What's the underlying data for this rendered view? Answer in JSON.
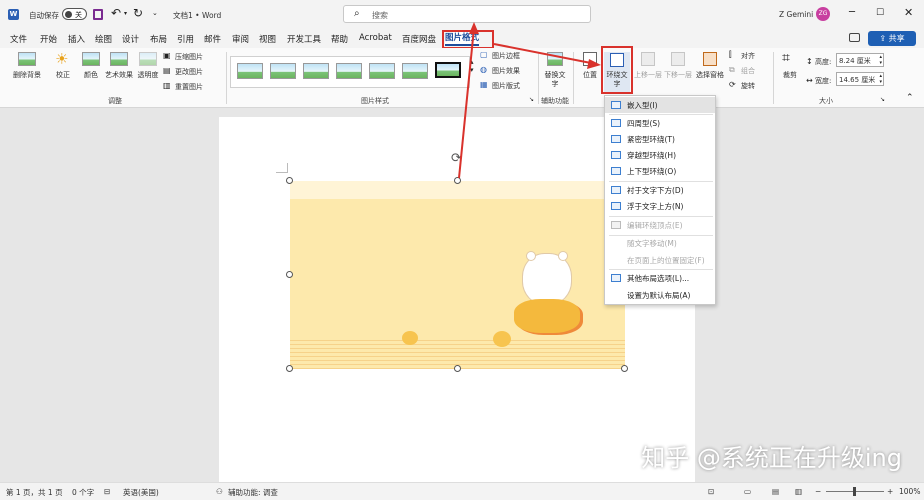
{
  "titlebar": {
    "autosave_label": "自动保存",
    "autosave_state": "关",
    "doc_title": "文档1  •  Word",
    "search_placeholder": "搜索",
    "user_name": "Z Gemini",
    "user_initials": "ZG"
  },
  "menu": {
    "tabs": [
      "文件",
      "开始",
      "插入",
      "绘图",
      "设计",
      "布局",
      "引用",
      "邮件",
      "审阅",
      "视图",
      "开发工具",
      "帮助",
      "Acrobat",
      "百度网盘"
    ],
    "active_tab": "图片格式",
    "share_label": "共享"
  },
  "ribbon": {
    "remove_bg": "删除背景",
    "correct": "校正",
    "color": "颜色",
    "artistic": "艺术效果",
    "transparency": "透明度",
    "compress": "压缩图片",
    "change_pic": "更改图片",
    "reset_pic": "重置图片",
    "group_adjust": "调整",
    "group_styles": "图片样式",
    "border": "图片边框",
    "effects": "图片效果",
    "layout": "图片版式",
    "alt_text": "替换文字",
    "group_access": "辅助功能",
    "position": "位置",
    "wrap_text": "环绕文字",
    "bring_forward": "上移一层",
    "send_backward": "下移一层",
    "selection_pane": "选择窗格",
    "align": "对齐",
    "group": "组合",
    "rotate": "旋转",
    "crop": "裁剪",
    "height_label": "高度:",
    "height_value": "8.24 厘米",
    "width_label": "宽度:",
    "width_value": "14.65 厘米",
    "group_size": "大小"
  },
  "wrap_menu": {
    "items": [
      {
        "label": "嵌入型(I)",
        "enabled": true,
        "selected": true
      },
      {
        "label": "四周型(S)",
        "enabled": true,
        "selected": false
      },
      {
        "label": "紧密型环绕(T)",
        "enabled": true,
        "selected": false
      },
      {
        "label": "穿越型环绕(H)",
        "enabled": true,
        "selected": false
      },
      {
        "label": "上下型环绕(O)",
        "enabled": true,
        "selected": false
      },
      {
        "label": "衬于文字下方(D)",
        "enabled": true,
        "selected": false
      },
      {
        "label": "浮于文字上方(N)",
        "enabled": true,
        "selected": false
      },
      {
        "label": "编辑环绕顶点(E)",
        "enabled": false,
        "selected": false
      },
      {
        "label": "随文字移动(M)",
        "enabled": false,
        "selected": false
      },
      {
        "label": "在页面上的位置固定(F)",
        "enabled": false,
        "selected": false
      },
      {
        "label": "其他布局选项(L)...",
        "enabled": true,
        "selected": false
      },
      {
        "label": "设置为默认布局(A)",
        "enabled": true,
        "selected": false
      }
    ]
  },
  "status": {
    "page": "第 1 页，共 1 页",
    "words": "0 个字",
    "language": "英语(美国)",
    "accessibility": "辅助功能: 调查",
    "zoom": "100%"
  },
  "watermark": "知乎 @系统正在升级ing",
  "colors": {
    "accent": "#1e4e9c",
    "annotation": "#d9322c",
    "image_bg": "#fde9ac"
  }
}
